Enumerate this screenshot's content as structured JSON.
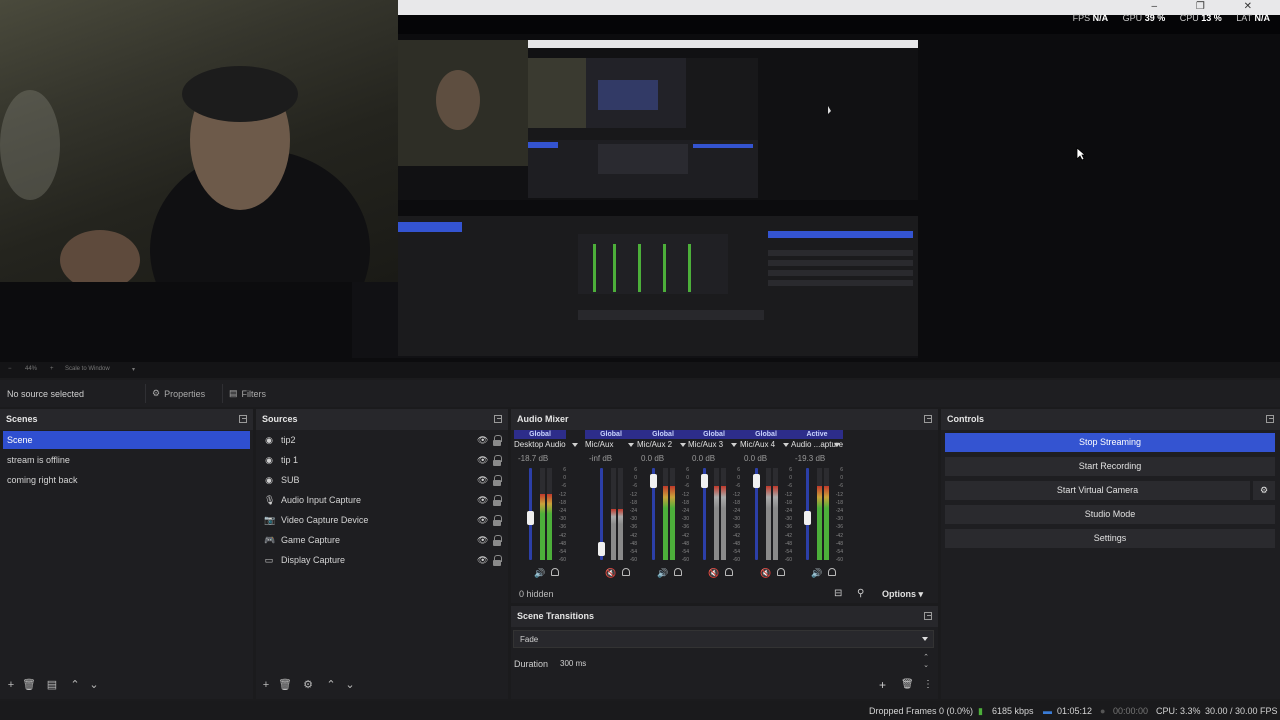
{
  "preview": {
    "stats": {
      "fps_label": "FPS",
      "fps_value": "N/A",
      "gpu_label": "GPU",
      "gpu_value": "39 %",
      "cpu_label": "CPU",
      "cpu_value": "13 %",
      "lat_label": "LAT",
      "lat_value": "N/A"
    },
    "zoom": {
      "value": "44%",
      "scale": "Scale to Window"
    }
  },
  "source_bar": {
    "no_source": "No source selected",
    "properties": "Properties",
    "filters": "Filters"
  },
  "scenes": {
    "title": "Scenes",
    "items": [
      {
        "label": "Scene",
        "selected": true
      },
      {
        "label": "stream is offline",
        "selected": false
      },
      {
        "label": "coming right back",
        "selected": false
      }
    ]
  },
  "sources": {
    "title": "Sources",
    "items": [
      {
        "label": "tip2",
        "icon": "image-icon"
      },
      {
        "label": "tip 1",
        "icon": "image-icon"
      },
      {
        "label": "SUB",
        "icon": "image-icon"
      },
      {
        "label": "Audio Input Capture",
        "icon": "microphone-icon"
      },
      {
        "label": "Video Capture Device",
        "icon": "camera-icon"
      },
      {
        "label": "Game Capture",
        "icon": "gamepad-icon"
      },
      {
        "label": "Display Capture",
        "icon": "monitor-icon"
      }
    ]
  },
  "mixer": {
    "title": "Audio Mixer",
    "hidden": "0 hidden",
    "options": "Options",
    "scale": [
      "6",
      "0",
      "-6",
      "-12",
      "-18",
      "-24",
      "-30",
      "-36",
      "-42",
      "-48",
      "-54",
      "-60"
    ],
    "channels": [
      {
        "tag": "Global",
        "name": "Desktop Audio",
        "db": "-18.7 dB",
        "level": 0.72,
        "fader": 0.45,
        "muted": false
      },
      {
        "tag": "Global",
        "name": "Mic/Aux",
        "db": "-inf dB",
        "level": 0.55,
        "fader": 0.05,
        "muted": true
      },
      {
        "tag": "Global",
        "name": "Mic/Aux 2",
        "db": "0.0 dB",
        "level": 0.8,
        "fader": 0.92,
        "muted": false
      },
      {
        "tag": "Global",
        "name": "Mic/Aux 3",
        "db": "0.0 dB",
        "level": 0.8,
        "fader": 0.92,
        "muted": true
      },
      {
        "tag": "Global",
        "name": "Mic/Aux 4",
        "db": "0.0 dB",
        "level": 0.8,
        "fader": 0.92,
        "muted": true
      },
      {
        "tag": "Active",
        "name": "Audio ...apture",
        "db": "-19.3 dB",
        "level": 0.8,
        "fader": 0.45,
        "muted": false
      }
    ]
  },
  "transitions": {
    "title": "Scene Transitions",
    "type": "Fade",
    "duration_label": "Duration",
    "duration_value": "300 ms"
  },
  "controls": {
    "title": "Controls",
    "stop_streaming": "Stop Streaming",
    "start_recording": "Start Recording",
    "start_virtual_camera": "Start Virtual Camera",
    "studio_mode": "Studio Mode",
    "settings": "Settings"
  },
  "status": {
    "dropped": "Dropped Frames 0 (0.0%)",
    "bitrate": "6185 kbps",
    "stream_time": "01:05:12",
    "rec_time": "00:00:00",
    "cpu": "CPU: 3.3%",
    "fps": "30.00 / 30.00 FPS"
  },
  "colors": {
    "accent": "#3454d1",
    "meter_green": "#4caf3a",
    "meter_yellow": "#c9a23a",
    "meter_red": "#c0392b"
  }
}
